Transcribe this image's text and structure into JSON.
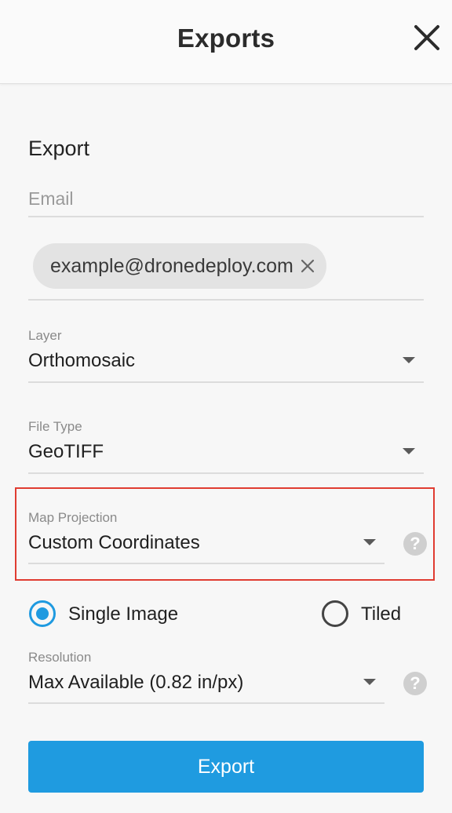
{
  "header": {
    "title": "Exports",
    "close_icon": "close-icon"
  },
  "form": {
    "section_title": "Export",
    "email": {
      "placeholder": "Email",
      "chips": [
        "example@dronedeploy.com"
      ],
      "chip_remove_icon": "close-icon"
    },
    "layer": {
      "label": "Layer",
      "value": "Orthomosaic"
    },
    "file_type": {
      "label": "File Type",
      "value": "GeoTIFF"
    },
    "map_projection": {
      "label": "Map Projection",
      "value": "Custom Coordinates",
      "help": "?"
    },
    "image_mode": {
      "options": [
        {
          "label": "Single Image",
          "selected": true
        },
        {
          "label": "Tiled",
          "selected": false
        }
      ]
    },
    "resolution": {
      "label": "Resolution",
      "value": "Max Available (0.82 in/px)",
      "help": "?"
    },
    "export_button": "Export"
  },
  "colors": {
    "accent": "#1f9be0",
    "highlight": "#e03c31",
    "background": "#f7f7f7"
  }
}
